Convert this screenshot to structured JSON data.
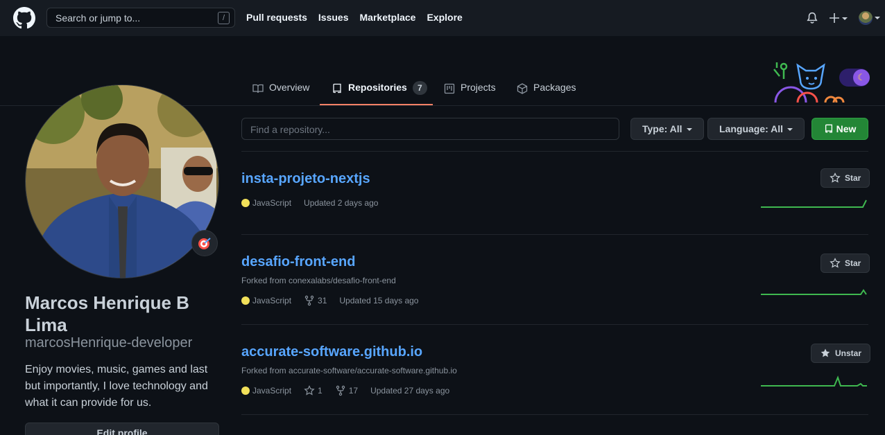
{
  "header": {
    "search_placeholder": "Search or jump to...",
    "search_shortcut": "/",
    "nav": [
      "Pull requests",
      "Issues",
      "Marketplace",
      "Explore"
    ]
  },
  "tabs": [
    {
      "label": "Overview",
      "icon": "book-icon"
    },
    {
      "label": "Repositories",
      "icon": "repo-icon",
      "count": "7",
      "active": true
    },
    {
      "label": "Projects",
      "icon": "project-icon"
    },
    {
      "label": "Packages",
      "icon": "package-icon"
    }
  ],
  "profile": {
    "full_name": "Marcos Henrique B Lima",
    "username": "marcosHenrique-developer",
    "bio": "Enjoy movies, music, games and last but importantly, I love technology and what it can provide for us.",
    "edit_label": "Edit profile",
    "status_icon": "dart-target-icon"
  },
  "filters": {
    "find_placeholder": "Find a repository...",
    "type_label": "Type: All",
    "language_label": "Language: All",
    "new_label": "New"
  },
  "colors": {
    "accent_link": "#58a6ff",
    "tab_underline": "#f78166",
    "new_button": "#238636",
    "javascript": "#f1e05a",
    "spark": "#3fb950"
  },
  "repos": [
    {
      "name": "insta-projeto-nextjs",
      "forked_from": "",
      "language": "JavaScript",
      "stars": "",
      "forks": "",
      "updated": "Updated 2 days ago",
      "star_label": "Star"
    },
    {
      "name": "desafio-front-end",
      "forked_from": "Forked from conexalabs/desafio-front-end",
      "language": "JavaScript",
      "stars": "",
      "forks": "31",
      "updated": "Updated 15 days ago",
      "star_label": "Star"
    },
    {
      "name": "accurate-software.github.io",
      "forked_from": "Forked from accurate-software/accurate-software.github.io",
      "language": "JavaScript",
      "stars": "1",
      "forks": "17",
      "updated": "Updated 27 days ago",
      "star_label": "Unstar"
    }
  ]
}
